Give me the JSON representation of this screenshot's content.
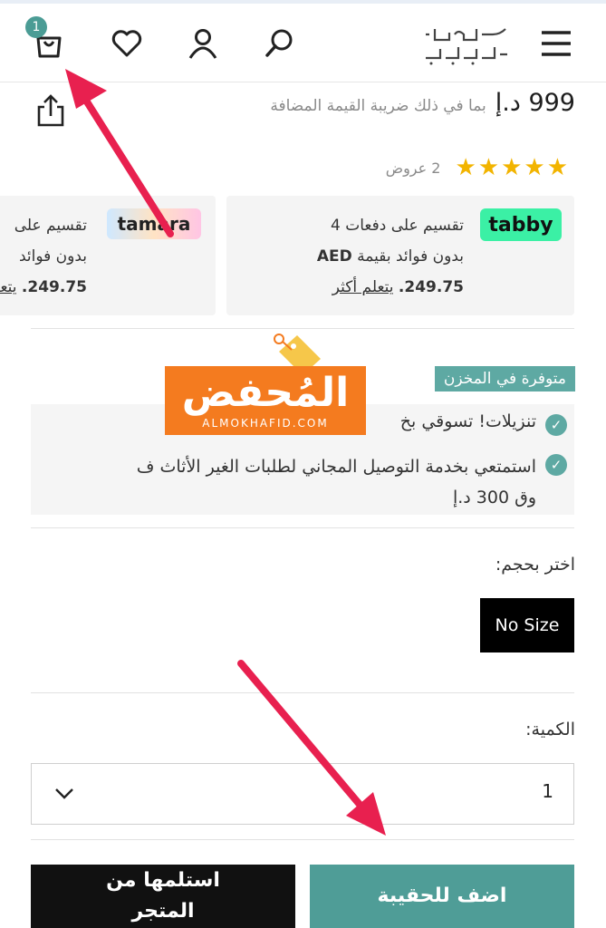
{
  "header": {
    "cart_count": "1",
    "logo_text": "ماماز باباز",
    "icons": [
      "bag-icon",
      "heart-icon",
      "user-icon",
      "search-icon",
      "menu-icon"
    ]
  },
  "product": {
    "price": "999 د.إ",
    "vat_note": "بما في ذلك ضريبة القيمة المضافة",
    "stars": "★★★★★",
    "offers": "2 عروض"
  },
  "tabby": {
    "logo": "tabby",
    "line1": "تقسيم على دفعات 4",
    "line2_a": "بدون فوائد بقيمة ",
    "line2_b": "AED",
    "amount": "249.75.",
    "learn_more": "يتعلم أكثر"
  },
  "tamara": {
    "logo": "tamara",
    "line1": "تقسيم على",
    "line2": "بدون فوائد",
    "amount": "249.75.",
    "learn_more": "يتعلم"
  },
  "stock": {
    "badge": "متوفرة في المخزن"
  },
  "benefits": {
    "item1": "تنزيلات! تسوقي بخ",
    "item2_line1": "استمتعي بخدمة التوصيل المجاني لطلبات الغير الأثاث ف",
    "item2_line2": "وق 300 د.إ"
  },
  "watermark": {
    "title": "المُحفض",
    "sub": "ALMOKHAFID.COM"
  },
  "size": {
    "label": "اختر بحجم:",
    "selected": "No Size"
  },
  "quantity": {
    "label": "الكمية:",
    "value": "1"
  },
  "buttons": {
    "add_to_bag": "اضف للحقيبة",
    "pickup_line1": "استلمها من",
    "pickup_line2": "المتجر"
  },
  "colors": {
    "accent": "#4f9d97",
    "arrow": "#e8204f",
    "star": "#f2b400",
    "watermark": "#f47b1f"
  }
}
